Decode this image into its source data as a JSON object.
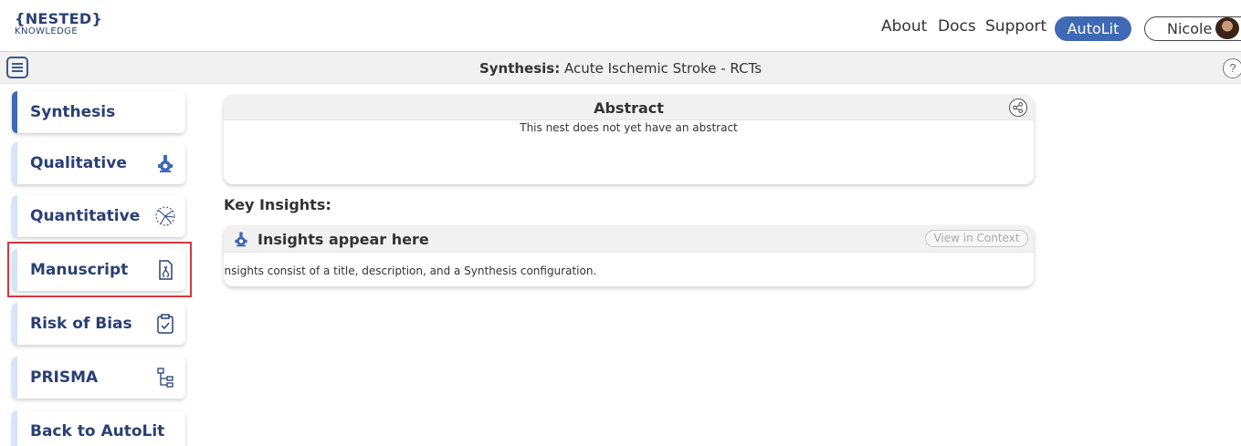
{
  "header": {
    "logo_top": "{NESTED}",
    "logo_bottom": "KNOWLEDGE",
    "nav": {
      "about": "About",
      "docs": "Docs",
      "support": "Support"
    },
    "autolit_label": "AutoLit",
    "user_name": "Nicole"
  },
  "subheader": {
    "title_bold": "Synthesis:",
    "title_rest": " Acute Ischemic Stroke - RCTs",
    "help_label": "?"
  },
  "sidebar": {
    "items": [
      {
        "label": "Synthesis",
        "icon": ""
      },
      {
        "label": "Qualitative",
        "icon": "qualitative-icon"
      },
      {
        "label": "Quantitative",
        "icon": "quantitative-icon"
      },
      {
        "label": "Manuscript",
        "icon": "manuscript-icon"
      },
      {
        "label": "Risk of Bias",
        "icon": "risk-of-bias-icon"
      },
      {
        "label": "PRISMA",
        "icon": "prisma-icon"
      },
      {
        "label": "Back to AutoLit",
        "icon": ""
      }
    ],
    "highlighted": "Manuscript"
  },
  "abstract": {
    "title": "Abstract",
    "text": "This nest does not yet have an abstract"
  },
  "key_insights": {
    "heading": "Key Insights:",
    "card_title": "Insights appear here",
    "context_button": "View in Context",
    "description": "Insights consist of a title, description, and a Synthesis configuration."
  },
  "colors": {
    "brand_blue": "#3f6ab3",
    "dark_blue": "#2a4073",
    "highlight_red": "#d9363e"
  }
}
